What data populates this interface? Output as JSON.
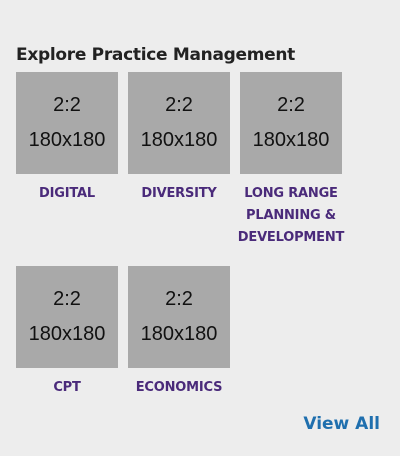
{
  "section": {
    "title": "Explore Practice Management"
  },
  "tiles": [
    {
      "ratio": "2:2",
      "size": "180x180",
      "label": "DIGITAL"
    },
    {
      "ratio": "2:2",
      "size": "180x180",
      "label": "DIVERSITY"
    },
    {
      "ratio": "2:2",
      "size": "180x180",
      "label": "LONG RANGE PLANNING & DEVELOPMENT"
    },
    {
      "ratio": "2:2",
      "size": "180x180",
      "label": "CPT"
    },
    {
      "ratio": "2:2",
      "size": "180x180",
      "label": "ECONOMICS"
    }
  ],
  "footer": {
    "view_all_label": "View All"
  },
  "colors": {
    "background": "#ededed",
    "thumbnail": "#a9a9a9",
    "label": "#4a2a7a",
    "link": "#1f6fae"
  }
}
